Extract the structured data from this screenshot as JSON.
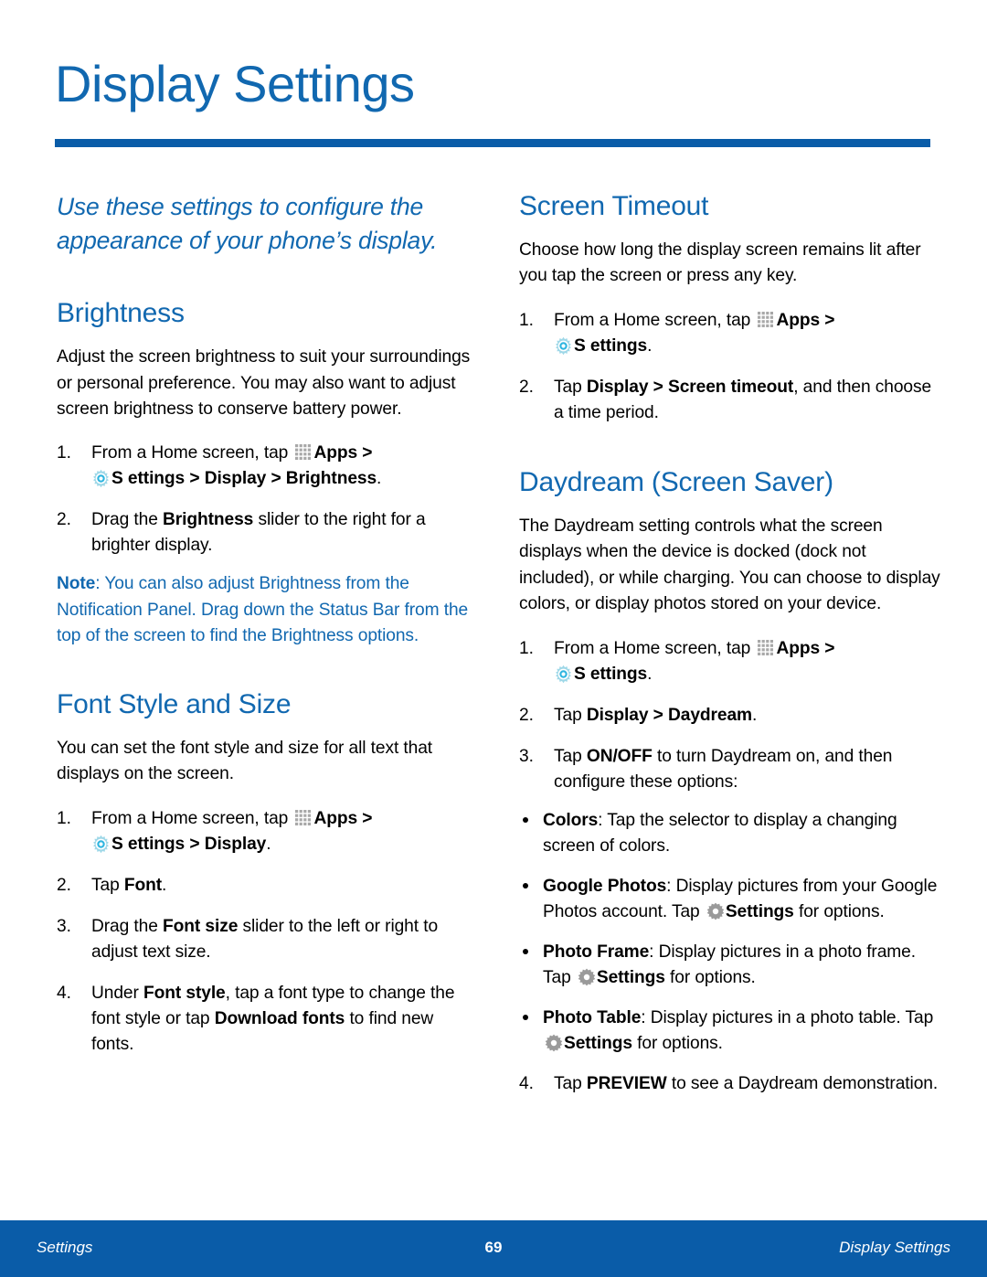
{
  "header": {
    "title": "Display Settings",
    "rule_color": "#0a5ca8"
  },
  "intro": "Use these settings to configure the appearance of your phone’s display.",
  "icons": {
    "apps": "apps-grid-icon",
    "settings_blue": "settings-gear-icon",
    "settings_gray": "settings-gear-gray-icon"
  },
  "left_column": {
    "brightness": {
      "heading": "Brightness",
      "body": "Adjust the screen brightness to suit your surroundings or personal preference. You may also want to adjust screen brightness to conserve battery power.",
      "steps": [
        {
          "num": "1.",
          "pre": "From a Home screen, tap ",
          "apps_label": "Apps",
          "mid": " > ",
          "settings_label": "S ettings",
          "post": " > Display > Brightness",
          "end": "."
        },
        {
          "num": "2.",
          "text_a": "Drag the ",
          "bold_a": "Brightness",
          "text_b": " slider to the right for a brighter display."
        }
      ],
      "note_label": "Note",
      "note_text": ": You can also adjust Brightness from the Notification Panel. Drag down the Status Bar from the top of the screen to find the Brightness options."
    },
    "font_style": {
      "heading": "Font Style and Size",
      "body": "You can set the font style and size for all text that displays on the screen.",
      "steps": [
        {
          "num": "1.",
          "pre": "From a Home screen, tap ",
          "apps_label": "Apps",
          "mid": " > ",
          "settings_label": "S ettings",
          "post": " > Display",
          "end": "."
        },
        {
          "num": "2.",
          "text_a": "Tap ",
          "bold_a": "Font",
          "text_b": "."
        },
        {
          "num": "3.",
          "text_a": "Drag the ",
          "bold_a": "Font size",
          "text_b": " slider to the left or right to adjust text size."
        },
        {
          "num": "4.",
          "text_a": "Under ",
          "bold_a": "Font style",
          "text_b": ", tap a font type to change the font style or tap ",
          "bold_b": "Download fonts",
          "text_c": " to find new fonts."
        }
      ]
    }
  },
  "right_column": {
    "screen_timeout": {
      "heading": "Screen Timeout",
      "body": "Choose how long the display screen remains lit after you tap the screen or press any key.",
      "steps": [
        {
          "num": "1.",
          "pre": "From a Home screen, tap ",
          "apps_label": "Apps",
          "mid": " > ",
          "settings_label": "S ettings",
          "post": "",
          "end": "."
        },
        {
          "num": "2.",
          "text_a": "Tap ",
          "bold_a": "Display > Screen timeout",
          "text_b": ", and then choose a time period."
        }
      ]
    },
    "daydream": {
      "heading": "Daydream (Screen Saver)",
      "body": "The Daydream setting controls what the screen displays when the device is docked (dock not included), or while charging. You can choose to display colors, or display photos stored on your device.",
      "steps": [
        {
          "num": "1.",
          "pre": "From a Home screen, tap ",
          "apps_label": "Apps",
          "mid": " > ",
          "settings_label": "S  ettings",
          "post": "",
          "end": "."
        },
        {
          "num": "2.",
          "text_a": "Tap ",
          "bold_a": "Display > Daydream",
          "text_b": "."
        },
        {
          "num": "3.",
          "text_a": "Tap ",
          "bold_a": "ON/OFF",
          "text_b": " to turn Daydream on, and then configure these options:"
        },
        {
          "num": "4.",
          "text_a": "Tap ",
          "bold_a": "PREVIEW",
          "text_b": " to see a Daydream demonstration."
        }
      ],
      "bullets": [
        {
          "label": "Colors",
          "text_a": ": Tap the selector to display a changing screen of colors.",
          "has_gear": false
        },
        {
          "label": "Google Photos",
          "text_a": ": Display pictures from your Google Photos account. Tap ",
          "gear_label": "Settings",
          "text_b": " for options.",
          "has_gear": true
        },
        {
          "label": "Photo Frame",
          "text_a": ": Display pictures in a photo frame. Tap ",
          "gear_label": "Settings",
          "text_b": "  for options.",
          "has_gear": true
        },
        {
          "label": "Photo Table",
          "text_a": ": Display pictures in a photo table. Tap ",
          "gear_label": "Settings",
          "text_b": " for options.",
          "has_gear": true
        }
      ]
    }
  },
  "footer": {
    "left": "Settings",
    "page_number": "69",
    "right": "Display Settings",
    "background": "#0a5ca8"
  }
}
